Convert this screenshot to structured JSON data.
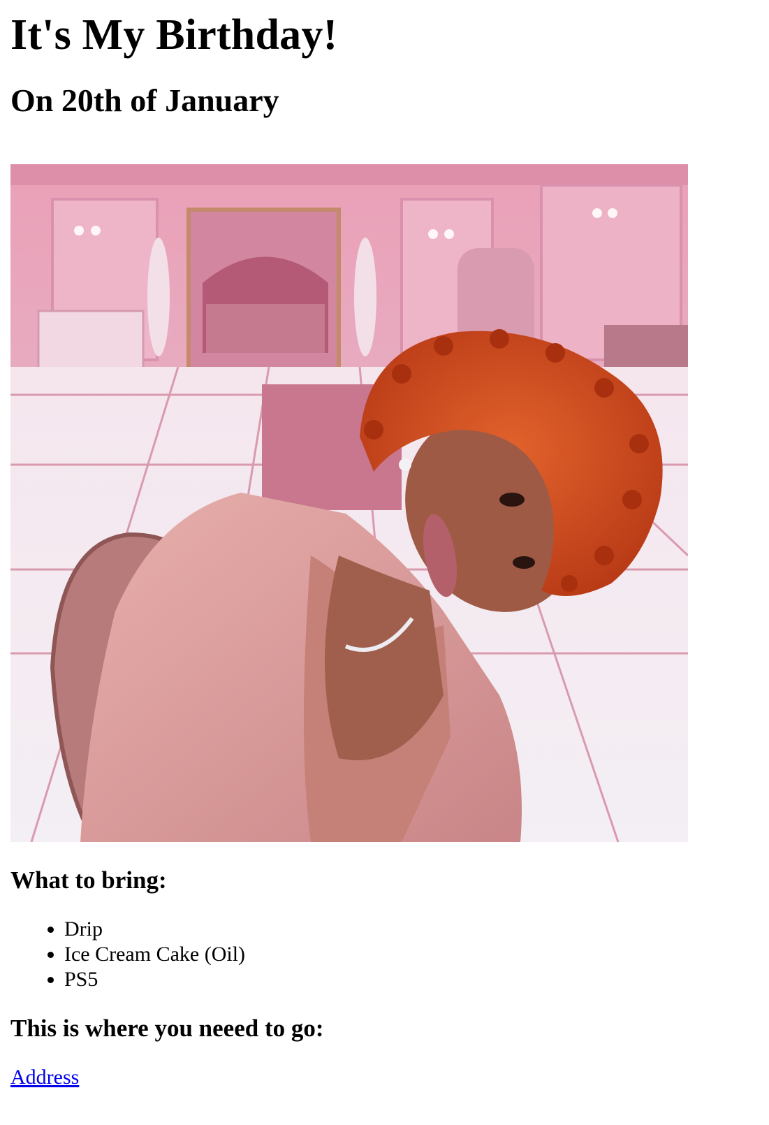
{
  "page": {
    "title": "It's My Birthday!",
    "subtitle": "On 20th of January"
  },
  "photo": {
    "background_color": "#e7a6bd",
    "floor_color": "#f1eef3",
    "hair_color": "#cf4a1f",
    "robe_color": "#d99a9a"
  },
  "bring": {
    "heading": "What to bring:",
    "items": [
      "Drip",
      "Ice Cream Cake (Oil)",
      "PS5"
    ]
  },
  "location": {
    "heading": "This is where you neeed to go:",
    "link_label": "Address"
  },
  "link_color": "#0000ee"
}
